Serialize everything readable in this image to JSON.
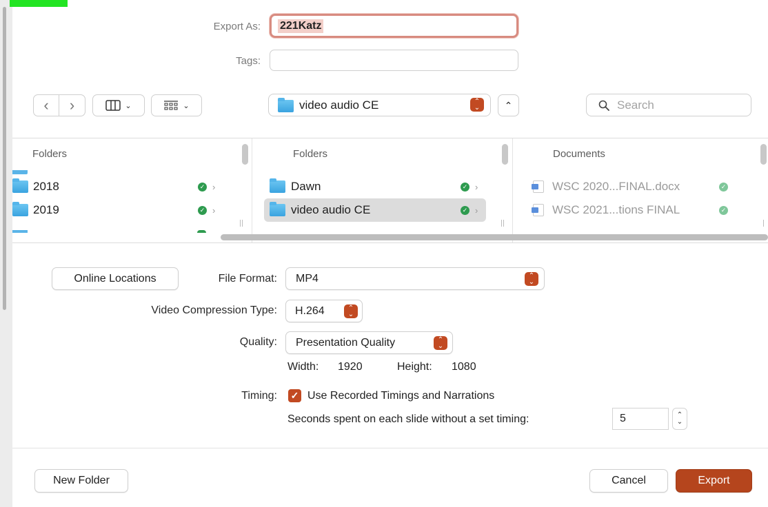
{
  "dialog": {
    "export_as_label": "Export As:",
    "export_as_value": "221Katz",
    "tags_label": "Tags:",
    "tags_value": ""
  },
  "toolbar": {
    "back_glyph": "‹",
    "forward_glyph": "›",
    "view_icon": "column-view-icon",
    "group_icon": "group-grid-icon",
    "current_folder": "video audio CE",
    "search_placeholder": "Search"
  },
  "browser": {
    "columns": [
      {
        "header": "Folders",
        "items": [
          {
            "name": "2018",
            "synced": true
          },
          {
            "name": "2019",
            "synced": true
          }
        ]
      },
      {
        "header": "Folders",
        "items": [
          {
            "name": "Dawn",
            "synced": true
          },
          {
            "name": "video audio CE",
            "synced": true,
            "selected": true
          }
        ]
      },
      {
        "header": "Documents",
        "items": [
          {
            "name": "WSC 2020...FINAL.docx",
            "synced": true
          },
          {
            "name": "WSC 2021...tions FINAL",
            "synced": true
          }
        ]
      }
    ]
  },
  "options": {
    "online_locations_label": "Online Locations",
    "file_format_label": "File Format:",
    "file_format_value": "MP4",
    "compression_label": "Video Compression Type:",
    "compression_value": "H.264",
    "quality_label": "Quality:",
    "quality_value": "Presentation Quality",
    "width_label": "Width:",
    "width_value": "1920",
    "height_label": "Height:",
    "height_value": "1080",
    "timing_label": "Timing:",
    "use_recorded_label": "Use Recorded Timings and Narrations",
    "use_recorded_checked": true,
    "seconds_label": "Seconds spent on each slide without a set timing:",
    "seconds_value": "5"
  },
  "footer": {
    "new_folder_label": "New Folder",
    "cancel_label": "Cancel",
    "export_label": "Export"
  },
  "colors": {
    "accent": "#b5451d",
    "focus_ring": "#d88b80",
    "synced_green": "#2e9b4f"
  }
}
